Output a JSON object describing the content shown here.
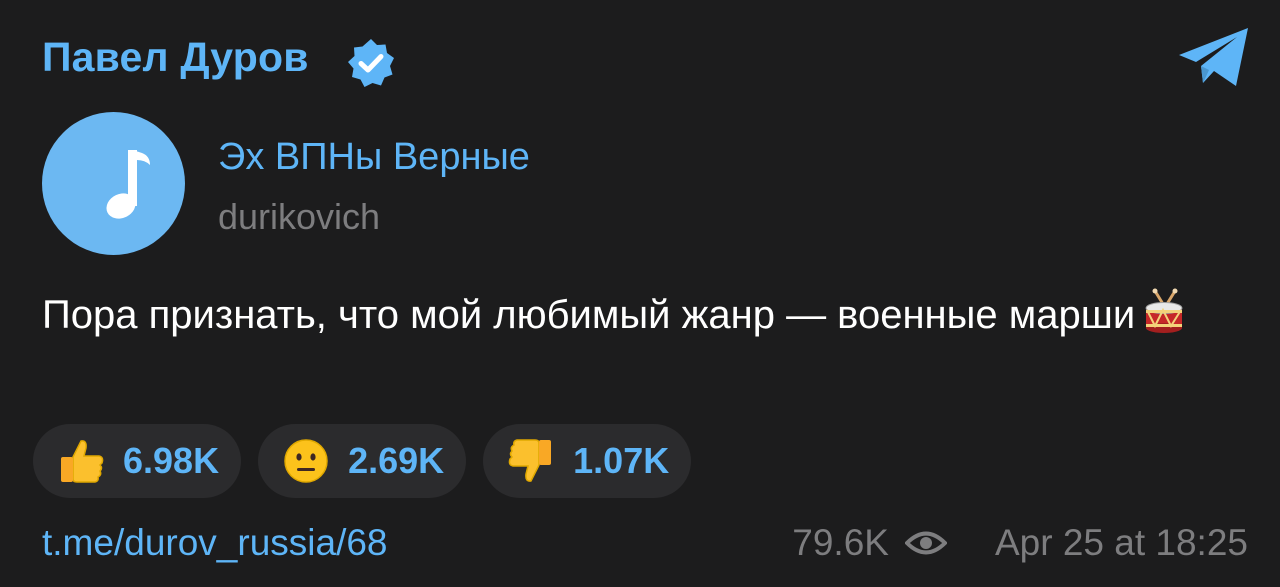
{
  "post": {
    "channel_name": "Павел Дуров",
    "verified_icon": "verified-badge-icon",
    "app_icon": "telegram-icon",
    "audio": {
      "icon": "music-note-icon",
      "title": "Эх ВПНы Верные",
      "author": "durikovich"
    },
    "text": "Пора признать, что мой любимый жанр — военные марши",
    "text_emoji": "drum-icon",
    "reactions": [
      {
        "icon": "thumbs-up-icon",
        "count": "6.98K"
      },
      {
        "icon": "neutral-face-icon",
        "count": "2.69K"
      },
      {
        "icon": "thumbs-down-icon",
        "count": "1.07K"
      }
    ],
    "link": "t.me/durov_russia/68",
    "views": "79.6K",
    "views_icon": "eye-icon",
    "date": "Apr 25 at 18:25"
  },
  "colors": {
    "background": "#1c1c1d",
    "accent": "#5eb5f7",
    "muted": "#7d7d7f",
    "reaction_bg": "#2b2b2d"
  }
}
